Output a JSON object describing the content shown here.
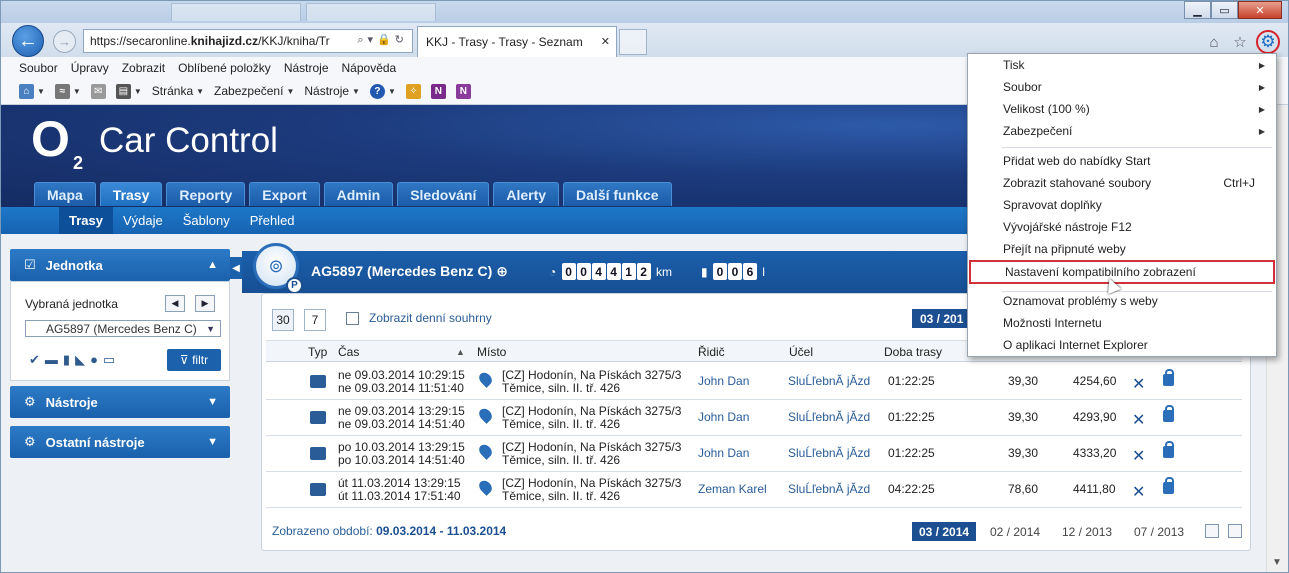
{
  "browser": {
    "address_scheme": "https://secaronline.",
    "address_host": "knihajizd.cz",
    "address_path": "/KKJ/kniha/Tr",
    "tab_title": "KKJ - Trasy - Trasy - Seznam",
    "menubar": [
      "Soubor",
      "Úpravy",
      "Zobrazit",
      "Oblíbené položky",
      "Nástroje",
      "Nápověda"
    ],
    "commands": {
      "page": "Stránka",
      "security": "Zabezpečení",
      "tools": "Nástroje"
    }
  },
  "app": {
    "logo_letter": "O",
    "logo_sub": "2",
    "logo_text": "Car Control",
    "main_tabs": [
      "Mapa",
      "Trasy",
      "Reporty",
      "Export",
      "Admin",
      "Sledování",
      "Alerty",
      "Další funkce"
    ],
    "sub_tabs": [
      "Trasy",
      "Výdaje",
      "Šablony",
      "Přehled"
    ]
  },
  "left": {
    "unit_header": "Jednotka",
    "selected_unit_label": "Vybraná jednotka",
    "selected_unit_value": "AG5897 (Mercedes Benz C)",
    "filter_button": "filtr",
    "tools_header": "Nástroje",
    "other_tools_header": "Ostatní nástroje"
  },
  "vehicle": {
    "title": "AG5897 (Mercedes Benz C)",
    "odometer_digits": [
      "0",
      "0",
      "4",
      "4",
      "1",
      "2"
    ],
    "odometer_unit": "km",
    "fuel_digits": [
      "0",
      "0",
      "6"
    ],
    "fuel_unit": "l"
  },
  "toolbar": {
    "day30": "30",
    "day7": "7",
    "daily_summary": "Zobrazit denní souhrny",
    "period_top": "03 / 201"
  },
  "table": {
    "headers": [
      "Typ",
      "Čas",
      "Místo",
      "Řidič",
      "Účel",
      "Doba trasy"
    ],
    "rows": [
      {
        "t1": "ne 09.03.2014 10:29:15",
        "t2": "ne 09.03.2014 11:51:40",
        "p1": "[CZ] Hodonín, Na Pískách 3275/3",
        "p2": "Těmice, siln. II. tř. 426",
        "driver": "John Dan",
        "purpose": "SluĹľebnĂ­ jĂzd",
        "dur": "01:22:25",
        "km": "39,30",
        "odo": "4254,60"
      },
      {
        "t1": "ne 09.03.2014 13:29:15",
        "t2": "ne 09.03.2014 14:51:40",
        "p1": "[CZ] Hodonín, Na Pískách 3275/3",
        "p2": "Těmice, siln. II. tř. 426",
        "driver": "John Dan",
        "purpose": "SluĹľebnĂ­ jĂzd",
        "dur": "01:22:25",
        "km": "39,30",
        "odo": "4293,90"
      },
      {
        "t1": "po 10.03.2014 13:29:15",
        "t2": "po 10.03.2014 14:51:40",
        "p1": "[CZ] Hodonín, Na Pískách 3275/3",
        "p2": "Těmice, siln. II. tř. 426",
        "driver": "John Dan",
        "purpose": "SluĹľebnĂ­ jĂzd",
        "dur": "01:22:25",
        "km": "39,30",
        "odo": "4333,20"
      },
      {
        "t1": "út 11.03.2014 13:29:15",
        "t2": "út 11.03.2014 17:51:40",
        "p1": "[CZ] Hodonín, Na Pískách 3275/3",
        "p2": "Těmice, siln. II. tř. 426",
        "driver": "Zeman Karel",
        "purpose": "SluĹľebnĂ­ jĂzd",
        "dur": "04:22:25",
        "km": "78,60",
        "odo": "4411,80"
      }
    ]
  },
  "footer": {
    "label": "Zobrazeno období:",
    "range": "09.03.2014 - 11.03.2014",
    "periods": [
      "03 / 2014",
      "02 / 2014",
      "12 / 2013",
      "07 / 2013"
    ]
  },
  "menu": {
    "items": [
      {
        "label": "Tisk",
        "sub": true
      },
      {
        "label": "Soubor",
        "sub": true
      },
      {
        "label": "Velikost (100 %)",
        "sub": true
      },
      {
        "label": "Zabezpečení",
        "sub": true
      },
      {
        "label": "Přidat web do nabídky Start"
      },
      {
        "label": "Zobrazit stahované soubory",
        "shortcut": "Ctrl+J"
      },
      {
        "label": "Spravovat doplňky"
      },
      {
        "label": "Vývojářské nástroje F12"
      },
      {
        "label": "Přejít na připnuté weby"
      },
      {
        "label": "Nastavení kompatibilního zobrazení"
      },
      {
        "label": "Oznamovat problémy s weby"
      },
      {
        "label": "Možnosti Internetu"
      },
      {
        "label": "O aplikaci Internet Explorer"
      }
    ]
  }
}
